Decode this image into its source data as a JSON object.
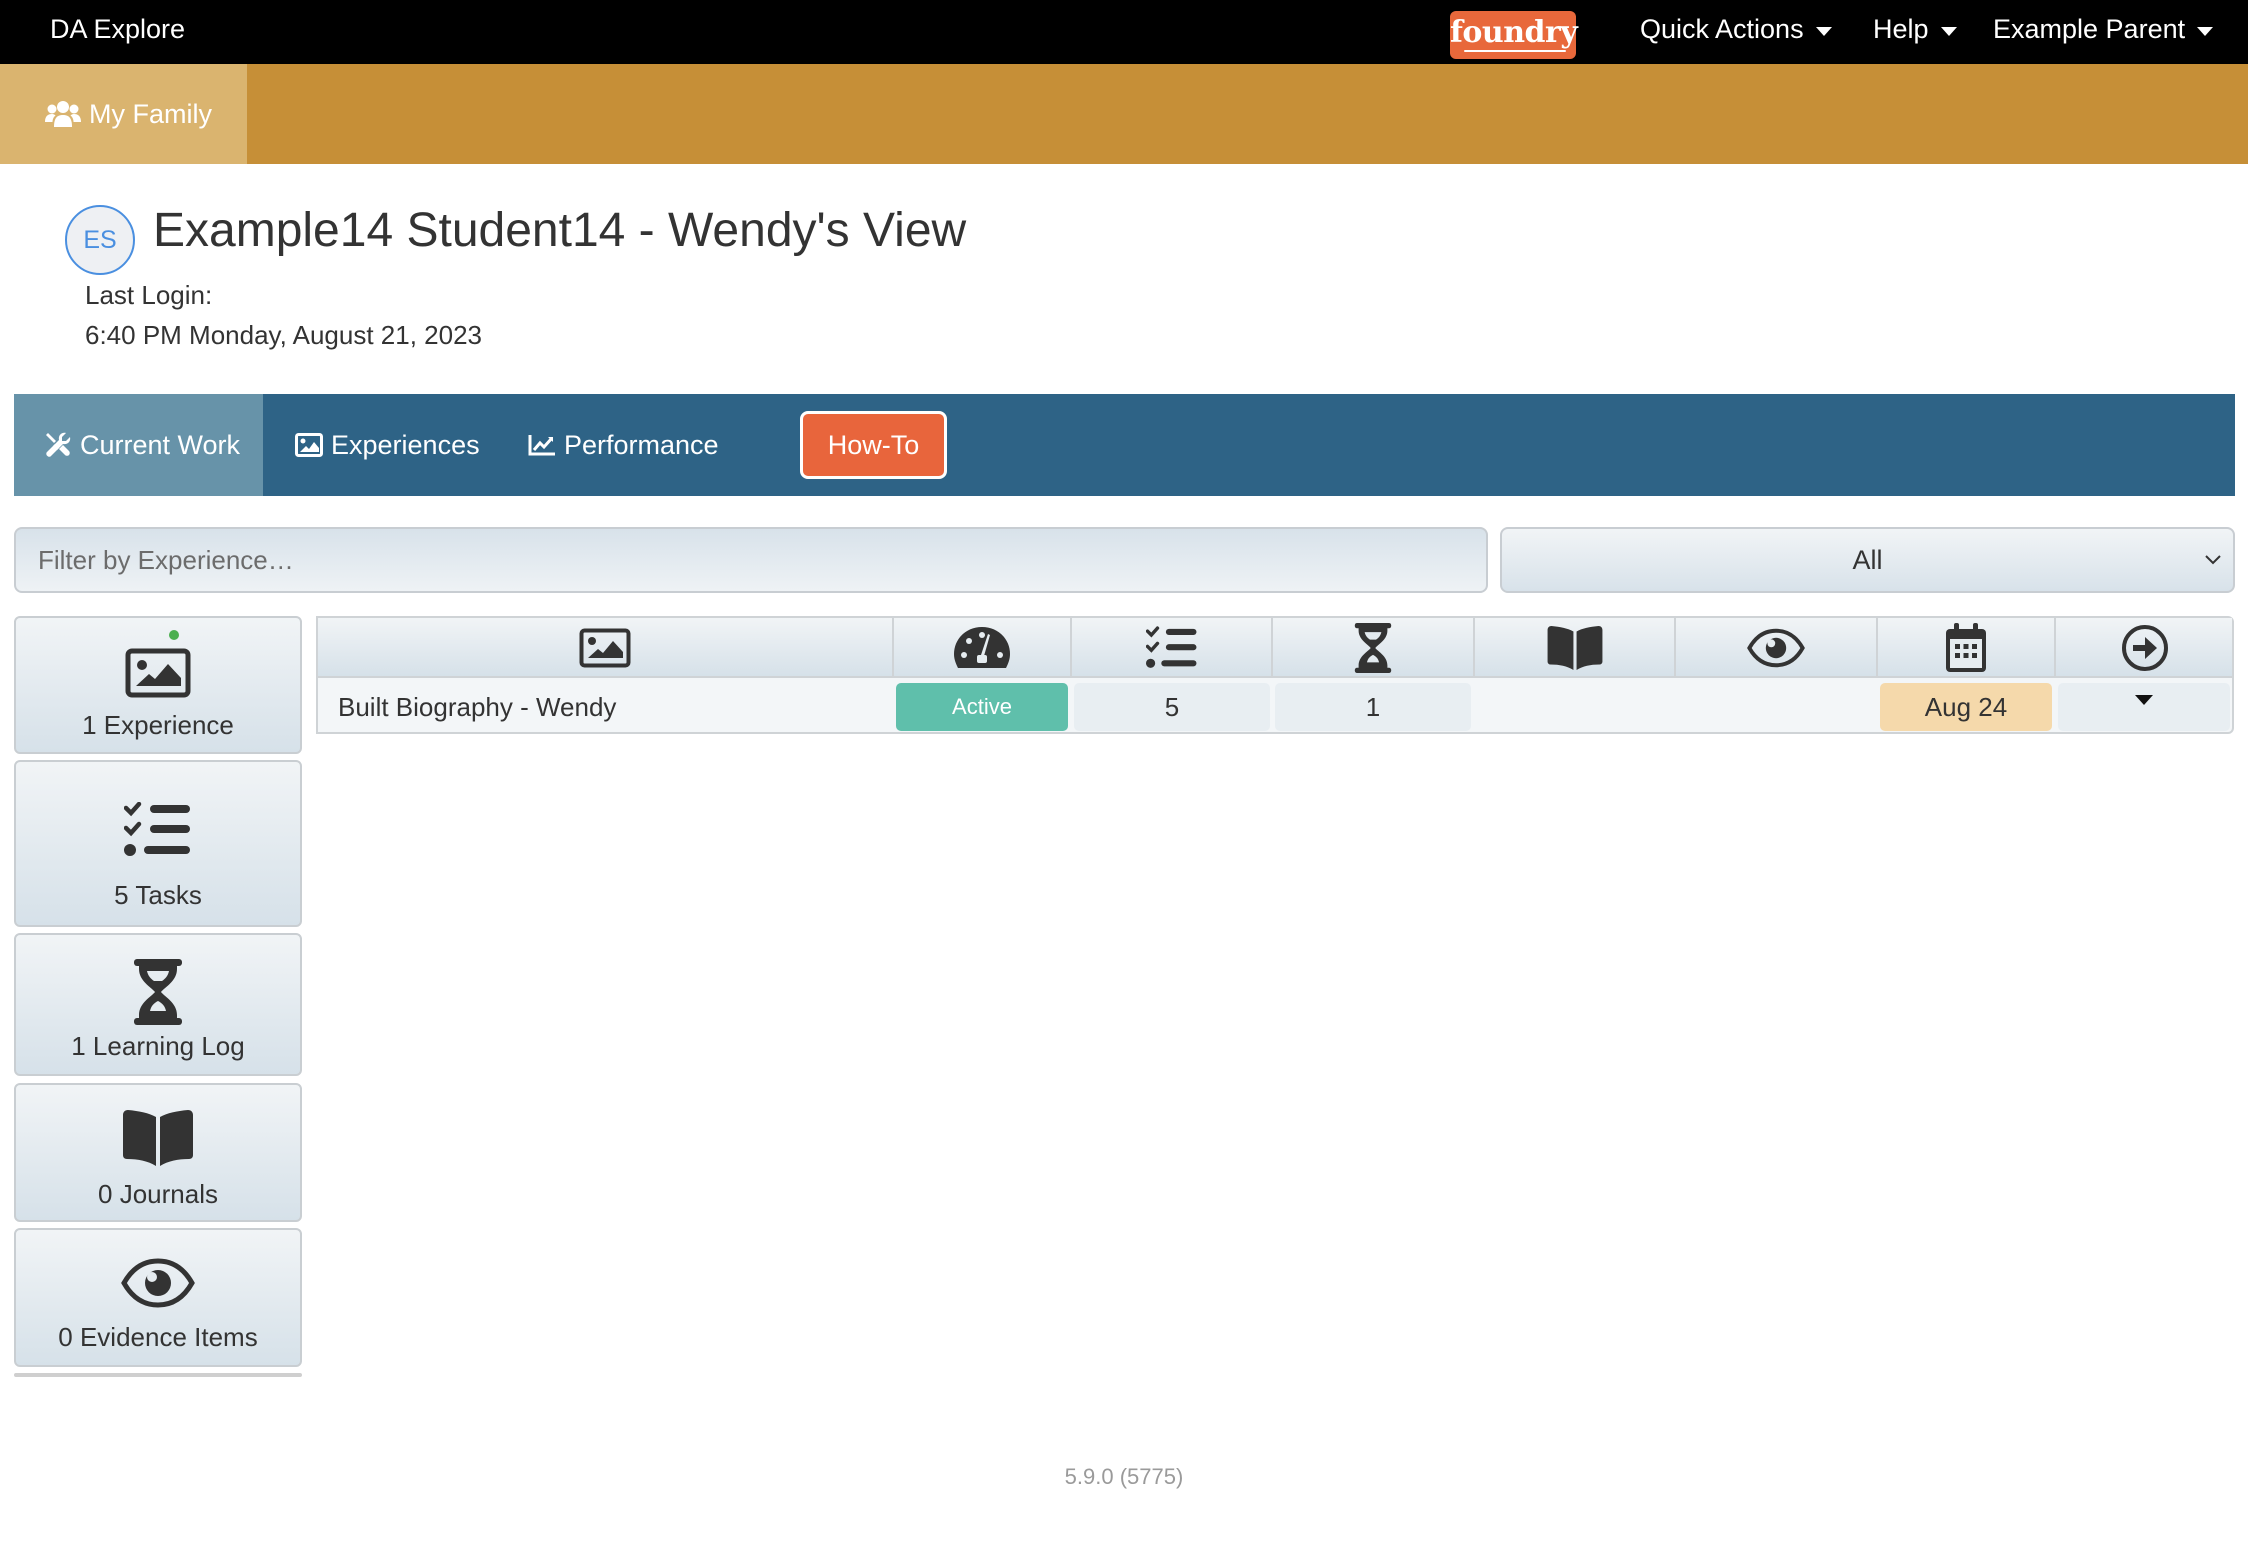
{
  "topbar": {
    "app_title": "DA Explore",
    "logo_text": "foundry",
    "menus": [
      {
        "label": "Quick Actions"
      },
      {
        "label": "Help"
      },
      {
        "label": "Example Parent"
      }
    ]
  },
  "subnav": {
    "family_tab": "My Family"
  },
  "student": {
    "initials": "ES",
    "title": "Example14 Student14 - Wendy's View",
    "last_login_label": "Last Login:",
    "last_login_value": "6:40 PM Monday, August 21, 2023"
  },
  "tabs": [
    {
      "label": "Current Work",
      "icon": "tools-icon",
      "active": true
    },
    {
      "label": "Experiences",
      "icon": "image-icon",
      "active": false
    },
    {
      "label": "Performance",
      "icon": "chart-line-icon",
      "active": false
    }
  ],
  "howto_label": "How-To",
  "filter": {
    "placeholder": "Filter by Experience…",
    "value": ""
  },
  "status_select": {
    "selected": "All"
  },
  "summary_tiles": [
    {
      "label": "1 Experience",
      "icon": "image-icon",
      "has_indicator": true
    },
    {
      "label": "5 Tasks",
      "icon": "tasks-icon"
    },
    {
      "label": "1 Learning Log",
      "icon": "hourglass-icon"
    },
    {
      "label": "0 Journals",
      "icon": "book-open-icon"
    },
    {
      "label": "0 Evidence Items",
      "icon": "eye-icon"
    }
  ],
  "table": {
    "columns": [
      {
        "icon": "image-icon",
        "meaning": "experience"
      },
      {
        "icon": "gauge-icon",
        "meaning": "status"
      },
      {
        "icon": "tasks-icon",
        "meaning": "tasks"
      },
      {
        "icon": "hourglass-icon",
        "meaning": "learning logs"
      },
      {
        "icon": "book-open-icon",
        "meaning": "journals"
      },
      {
        "icon": "eye-icon",
        "meaning": "evidence"
      },
      {
        "icon": "calendar-icon",
        "meaning": "due date"
      },
      {
        "icon": "arrow-circle-right-icon",
        "meaning": "actions"
      }
    ],
    "rows": [
      {
        "name": "Built Biography - Wendy",
        "status": "Active",
        "tasks": "5",
        "learning_logs": "1",
        "journals": "",
        "evidence": "",
        "due": "Aug 24"
      }
    ]
  },
  "colors": {
    "topbar": "#000000",
    "gold": "#c68f37",
    "gold_active": "#dab46f",
    "nav_blue": "#2e6386",
    "nav_active": "#6793a9",
    "howto_orange": "#e8653c",
    "logo_orange": "#e8683b",
    "status_active": "#5fbfab",
    "due_date_bg": "#f5d9ab"
  },
  "footer": {
    "version": "5.9.0 (5775)"
  }
}
